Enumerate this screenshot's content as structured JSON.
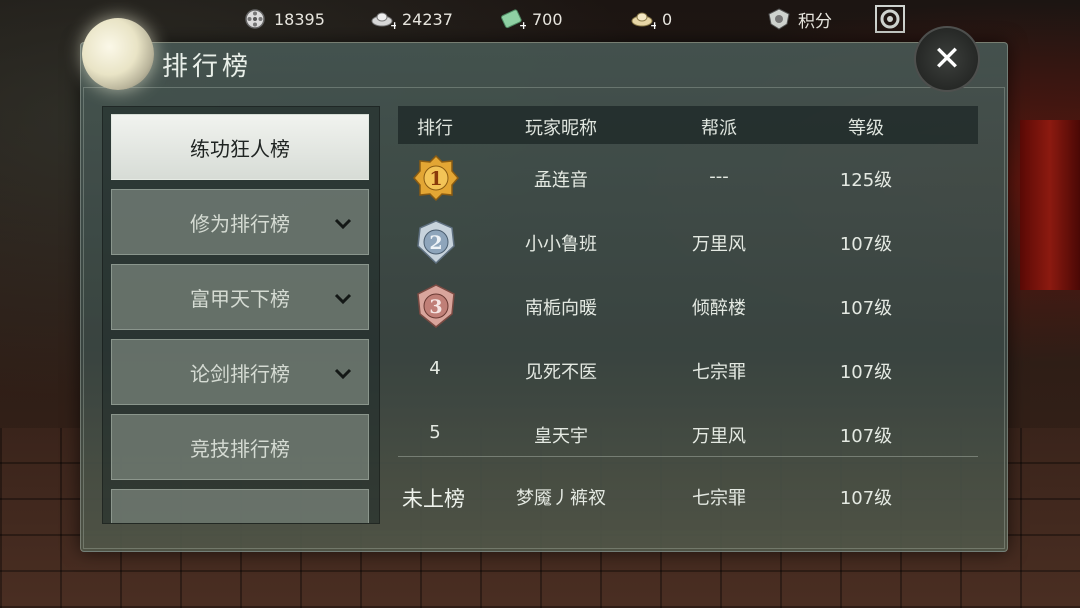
{
  "resources": {
    "coin": {
      "icon": "film-reel-icon",
      "value": "18395"
    },
    "silver": {
      "icon": "silver-ingot-add-icon",
      "value": "24237"
    },
    "jade": {
      "icon": "jade-ticket-add-icon",
      "value": "700"
    },
    "ingot": {
      "icon": "gold-ingot-add-icon",
      "value": "0"
    },
    "points": {
      "icon": "shield-points-icon",
      "label": "积分"
    },
    "settings_icon": "settings-icon"
  },
  "panel": {
    "title": "排行榜",
    "close_icon": "close-icon"
  },
  "tabs": [
    {
      "label": "练功狂人榜",
      "active": true,
      "expandable": false
    },
    {
      "label": "修为排行榜",
      "active": false,
      "expandable": true
    },
    {
      "label": "富甲天下榜",
      "active": false,
      "expandable": true
    },
    {
      "label": "论剑排行榜",
      "active": false,
      "expandable": true
    },
    {
      "label": "竞技排行榜",
      "active": false,
      "expandable": false
    },
    {
      "label": "",
      "active": false,
      "expandable": false
    }
  ],
  "table": {
    "headers": {
      "rank": "排行",
      "name": "玩家昵称",
      "guild": "帮派",
      "level": "等级"
    },
    "rows": [
      {
        "rank": "1",
        "badge": "gold",
        "name": "孟连音",
        "guild": "---",
        "level": "125级"
      },
      {
        "rank": "2",
        "badge": "silver",
        "name": "小小鲁班",
        "guild": "万里风",
        "level": "107级"
      },
      {
        "rank": "3",
        "badge": "bronze",
        "name": "南栀向暖",
        "guild": "倾醉楼",
        "level": "107级"
      },
      {
        "rank": "4",
        "badge": "",
        "name": "见死不医",
        "guild": "七宗罪",
        "level": "107级"
      },
      {
        "rank": "5",
        "badge": "",
        "name": "皇天宇",
        "guild": "万里风",
        "level": "107级"
      }
    ],
    "self": {
      "rank": "未上榜",
      "name": "梦魇丿裤衩",
      "guild": "七宗罪",
      "level": "107级"
    }
  },
  "colors": {
    "gold": "#d99a2b",
    "silver": "#9fb2c2",
    "bronze": "#c98b82",
    "panel": "#46564f"
  }
}
